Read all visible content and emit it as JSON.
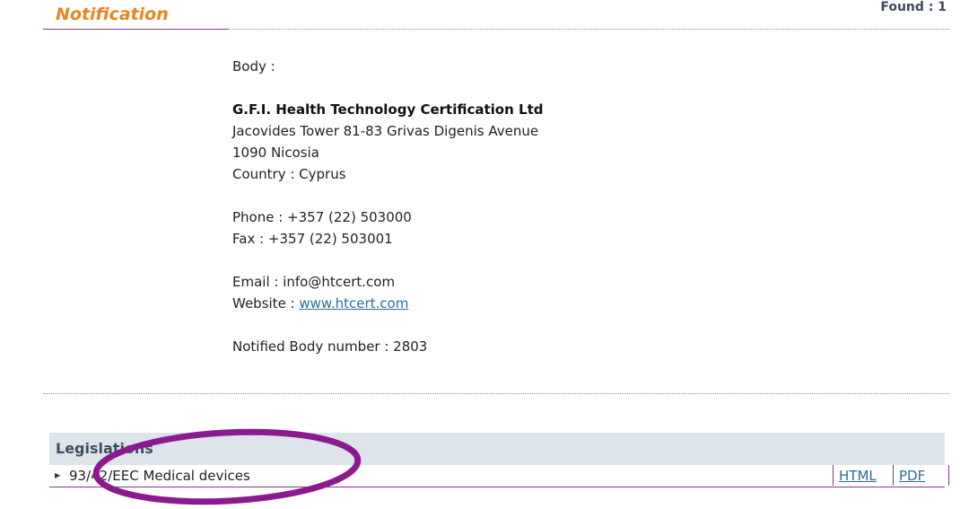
{
  "header": {
    "title": "Notification",
    "found": "Found : 1"
  },
  "body_info": {
    "label": "Body :",
    "name": "G.F.I. Health Technology Certification Ltd",
    "address_line1": "Jacovides Tower 81-83 Grivas Digenis Avenue",
    "address_line2": "1090 Nicosia",
    "country": "Country : Cyprus",
    "phone": "Phone : +357 (22) 503000",
    "fax": "Fax : +357 (22) 503001",
    "email": "Email : info@htcert.com",
    "website_label": "Website : ",
    "website_link": "www.htcert.com",
    "nb_number": "Notified Body number : 2803"
  },
  "legislations": {
    "title": "Legislations",
    "items": [
      {
        "text": "93/42/EEC Medical devices",
        "html_label": "HTML",
        "pdf_label": "PDF"
      }
    ]
  },
  "colors": {
    "accent_orange": "#e8861c",
    "accent_purple": "#7b3b86",
    "link_blue": "#2a6f97",
    "panel_gray": "#dde5ea",
    "annotation_ellipse": "#8b1a8f"
  }
}
